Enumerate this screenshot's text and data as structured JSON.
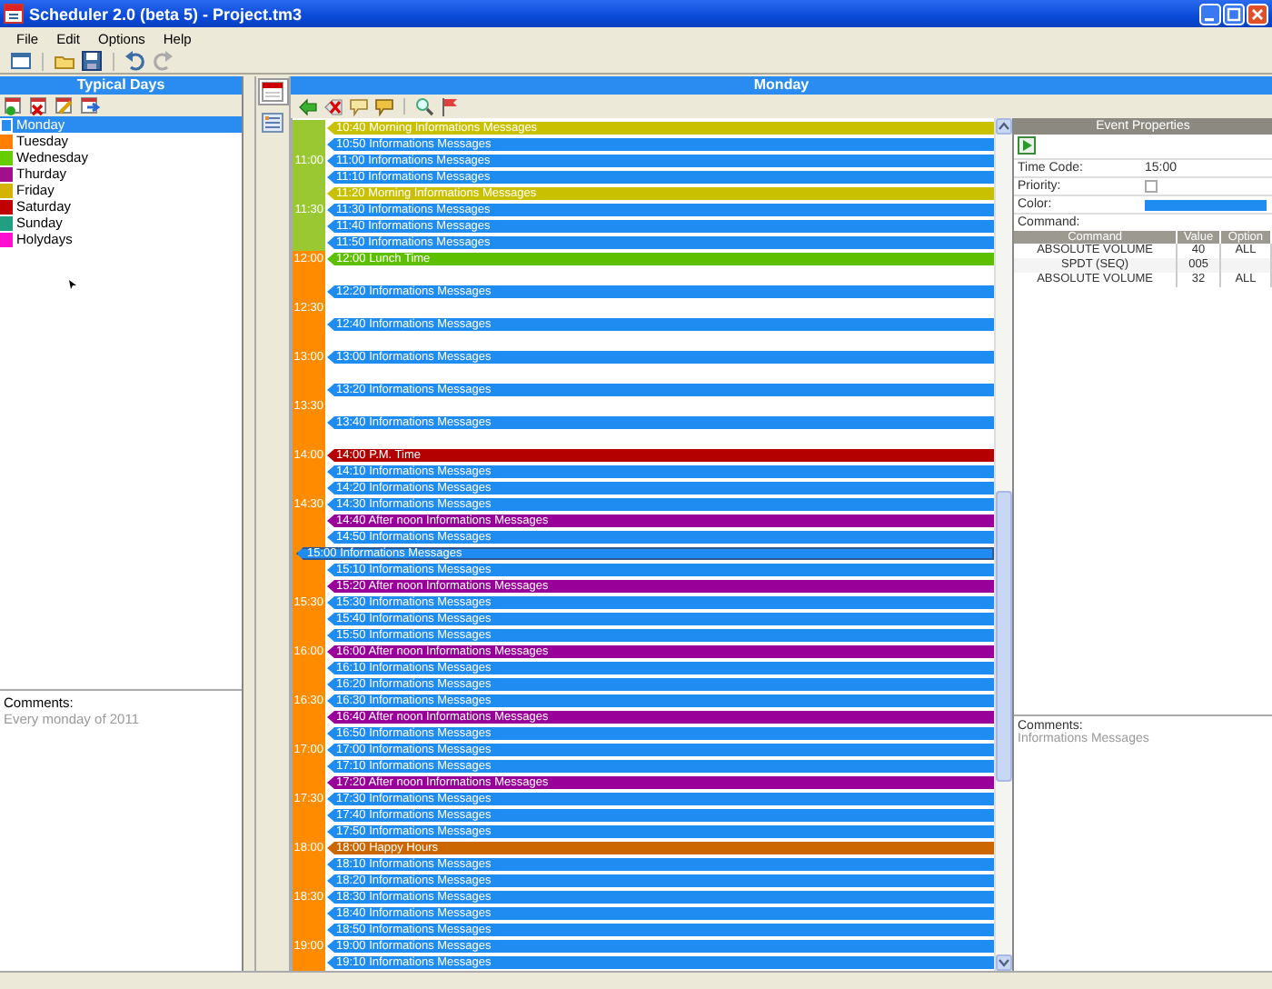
{
  "window": {
    "title": "Scheduler 2.0 (beta 5) - Project.tm3"
  },
  "menu": [
    "File",
    "Edit",
    "Options",
    "Help"
  ],
  "view_tabs": [
    {
      "selected": true
    },
    {
      "selected": false
    }
  ],
  "typical_days": {
    "title": "Typical Days",
    "items": [
      {
        "label": "Monday",
        "color": "#2a8cf0",
        "selected": true
      },
      {
        "label": "Tuesday",
        "color": "#ff8000",
        "selected": false
      },
      {
        "label": "Wednesday",
        "color": "#66cc00",
        "selected": false
      },
      {
        "label": "Thurday",
        "color": "#a0108c",
        "selected": false
      },
      {
        "label": "Friday",
        "color": "#d4b400",
        "selected": false
      },
      {
        "label": "Saturday",
        "color": "#c00000",
        "selected": false
      },
      {
        "label": "Sunday",
        "color": "#20a080",
        "selected": false
      },
      {
        "label": "Holydays",
        "color": "#ff10d0",
        "selected": false
      }
    ],
    "comments_label": "Comments:",
    "comments": "Every monday of 2011"
  },
  "schedule": {
    "title": "Monday",
    "periods": [
      {
        "color": "#99c833",
        "slots": [
          {
            "kind": "event",
            "text": "10:40 Morning Informations Messages",
            "color": "#c8c000",
            "selected": false
          },
          {
            "kind": "event",
            "text": "10:50 Informations Messages",
            "color": "#1e8cf0",
            "selected": false
          },
          {
            "kind": "event",
            "mark": "11:00",
            "text": "11:00 Informations Messages",
            "color": "#1e8cf0",
            "selected": false
          },
          {
            "kind": "event",
            "text": "11:10 Informations Messages",
            "color": "#1e8cf0",
            "selected": false
          },
          {
            "kind": "event",
            "text": "11:20 Morning Informations Messages",
            "color": "#c8c000",
            "selected": false
          },
          {
            "kind": "event",
            "mark": "11:30",
            "text": "11:30 Informations Messages",
            "color": "#1e8cf0",
            "selected": false
          },
          {
            "kind": "event",
            "text": "11:40 Informations Messages",
            "color": "#1e8cf0",
            "selected": false
          },
          {
            "kind": "event",
            "text": "11:50 Informations Messages",
            "color": "#1e8cf0",
            "selected": false
          }
        ]
      },
      {
        "color": "#ff8c00",
        "slots": [
          {
            "kind": "event",
            "mark": "12:00",
            "text": "12:00 Lunch Time",
            "color": "#5cbf00",
            "selected": false
          },
          {
            "kind": "empty"
          },
          {
            "kind": "event",
            "text": "12:20 Informations Messages",
            "color": "#1e8cf0",
            "selected": false
          },
          {
            "kind": "empty",
            "mark": "12:30"
          },
          {
            "kind": "event",
            "text": "12:40 Informations Messages",
            "color": "#1e8cf0",
            "selected": false
          },
          {
            "kind": "empty"
          },
          {
            "kind": "event",
            "mark": "13:00",
            "text": "13:00 Informations Messages",
            "color": "#1e8cf0",
            "selected": false
          },
          {
            "kind": "empty"
          },
          {
            "kind": "event",
            "text": "13:20 Informations Messages",
            "color": "#1e8cf0",
            "selected": false
          },
          {
            "kind": "empty",
            "mark": "13:30"
          },
          {
            "kind": "event",
            "text": "13:40 Informations Messages",
            "color": "#1e8cf0",
            "selected": false
          },
          {
            "kind": "empty"
          },
          {
            "kind": "event",
            "mark": "14:00",
            "text": "14:00 P.M. Time",
            "color": "#b40000",
            "selected": false
          },
          {
            "kind": "event",
            "text": "14:10 Informations Messages",
            "color": "#1e8cf0",
            "selected": false
          },
          {
            "kind": "event",
            "text": "14:20 Informations Messages",
            "color": "#1e8cf0",
            "selected": false
          },
          {
            "kind": "event",
            "mark": "14:30",
            "text": "14:30 Informations Messages",
            "color": "#1e8cf0",
            "selected": false
          },
          {
            "kind": "event",
            "text": "14:40 After noon Informations Messages",
            "color": "#990099",
            "selected": false
          },
          {
            "kind": "event",
            "text": "14:50 Informations Messages",
            "color": "#1e8cf0",
            "selected": false
          },
          {
            "kind": "event",
            "text": "15:00 Informations Messages",
            "color": "#1e8cf0",
            "selected": true
          },
          {
            "kind": "event",
            "text": "15:10 Informations Messages",
            "color": "#1e8cf0",
            "selected": false
          },
          {
            "kind": "event",
            "text": "15:20 After noon Informations Messages",
            "color": "#990099",
            "selected": false
          },
          {
            "kind": "event",
            "mark": "15:30",
            "text": "15:30 Informations Messages",
            "color": "#1e8cf0",
            "selected": false
          },
          {
            "kind": "event",
            "text": "15:40 Informations Messages",
            "color": "#1e8cf0",
            "selected": false
          },
          {
            "kind": "event",
            "text": "15:50 Informations Messages",
            "color": "#1e8cf0",
            "selected": false
          },
          {
            "kind": "event",
            "mark": "16:00",
            "text": "16:00 After noon Informations Messages",
            "color": "#990099",
            "selected": false
          },
          {
            "kind": "event",
            "text": "16:10 Informations Messages",
            "color": "#1e8cf0",
            "selected": false
          },
          {
            "kind": "event",
            "text": "16:20 Informations Messages",
            "color": "#1e8cf0",
            "selected": false
          },
          {
            "kind": "event",
            "mark": "16:30",
            "text": "16:30 Informations Messages",
            "color": "#1e8cf0",
            "selected": false
          },
          {
            "kind": "event",
            "text": "16:40 After noon Informations Messages",
            "color": "#990099",
            "selected": false
          },
          {
            "kind": "event",
            "text": "16:50 Informations Messages",
            "color": "#1e8cf0",
            "selected": false
          },
          {
            "kind": "event",
            "mark": "17:00",
            "text": "17:00 Informations Messages",
            "color": "#1e8cf0",
            "selected": false
          },
          {
            "kind": "event",
            "text": "17:10 Informations Messages",
            "color": "#1e8cf0",
            "selected": false
          },
          {
            "kind": "event",
            "text": "17:20 After noon Informations Messages",
            "color": "#990099",
            "selected": false
          },
          {
            "kind": "event",
            "mark": "17:30",
            "text": "17:30 Informations Messages",
            "color": "#1e8cf0",
            "selected": false
          },
          {
            "kind": "event",
            "text": "17:40 Informations Messages",
            "color": "#1e8cf0",
            "selected": false
          },
          {
            "kind": "event",
            "text": "17:50 Informations Messages",
            "color": "#1e8cf0",
            "selected": false
          },
          {
            "kind": "event",
            "mark": "18:00",
            "text": "18:00 Happy Hours",
            "color": "#cc6600",
            "selected": false
          },
          {
            "kind": "event",
            "text": "18:10 Informations Messages",
            "color": "#1e8cf0",
            "selected": false
          },
          {
            "kind": "event",
            "text": "18:20 Informations Messages",
            "color": "#1e8cf0",
            "selected": false
          },
          {
            "kind": "event",
            "mark": "18:30",
            "text": "18:30 Informations Messages",
            "color": "#1e8cf0",
            "selected": false
          },
          {
            "kind": "event",
            "text": "18:40 Informations Messages",
            "color": "#1e8cf0",
            "selected": false
          },
          {
            "kind": "event",
            "text": "18:50 Informations Messages",
            "color": "#1e8cf0",
            "selected": false
          },
          {
            "kind": "event",
            "mark": "19:00",
            "text": "19:00 Informations Messages",
            "color": "#1e8cf0",
            "selected": false
          },
          {
            "kind": "event",
            "text": "19:10 Informations Messages",
            "color": "#1e8cf0",
            "selected": false
          }
        ]
      }
    ]
  },
  "event_properties": {
    "title": "Event Properties",
    "fields": [
      {
        "kind": "text",
        "label": "Time Code:",
        "value": "15:00"
      },
      {
        "kind": "checkbox",
        "label": "Priority:",
        "checked": false
      },
      {
        "kind": "color",
        "label": "Color:",
        "color": "#1e8cf0"
      },
      {
        "kind": "heading",
        "label": "Command:"
      }
    ],
    "columns": [
      "Command",
      "Value",
      "Option"
    ],
    "rows": [
      {
        "command": "ABSOLUTE VOLUME",
        "value": "40",
        "option": "ALL"
      },
      {
        "command": "SPDT (SEQ)",
        "value": "005"
      },
      {
        "command": "ABSOLUTE VOLUME",
        "value": "32",
        "option": "ALL"
      }
    ],
    "comments_label": "Comments:",
    "comments": "Informations Messages"
  }
}
